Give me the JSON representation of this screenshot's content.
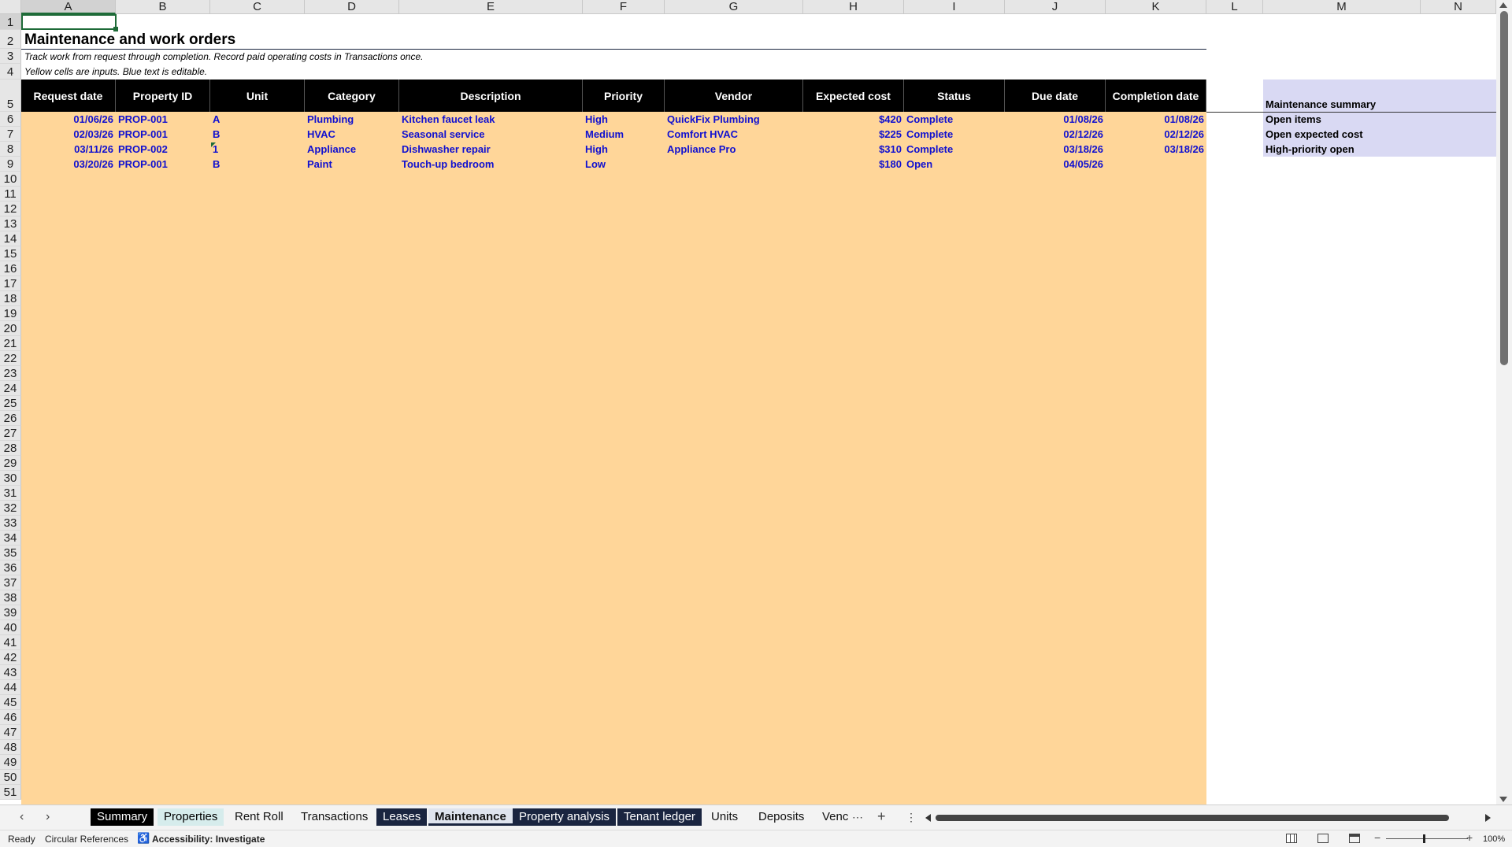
{
  "columns": [
    "A",
    "B",
    "C",
    "D",
    "E",
    "F",
    "G",
    "H",
    "I",
    "J",
    "K",
    "L",
    "M",
    "N"
  ],
  "rows_visible": [
    "1",
    "2",
    "3",
    "4",
    "5",
    "6",
    "7",
    "8",
    "9",
    "10",
    "11",
    "12",
    "13",
    "14",
    "15",
    "16",
    "17",
    "18",
    "19",
    "20",
    "21",
    "22",
    "23",
    "24",
    "25",
    "26",
    "27",
    "28",
    "29",
    "30",
    "31",
    "32",
    "33",
    "34",
    "35",
    "36",
    "37",
    "38",
    "39",
    "40",
    "41",
    "42",
    "43",
    "44",
    "45",
    "46",
    "47",
    "48",
    "49",
    "50",
    "51"
  ],
  "sheet": {
    "title": "Maintenance and work orders",
    "note1": "Track work from request through completion. Record paid operating costs in Transactions once.",
    "note2": "Yellow cells are inputs. Blue text is editable."
  },
  "table": {
    "headers": [
      "Request date",
      "Property ID",
      "Unit",
      "Category",
      "Description",
      "Priority",
      "Vendor",
      "Expected cost",
      "Status",
      "Due date",
      "Completion date"
    ],
    "rows": [
      [
        "01/06/26",
        "PROP-001",
        "A",
        "Plumbing",
        "Kitchen faucet leak",
        "High",
        "QuickFix Plumbing",
        "$420",
        "Complete",
        "01/08/26",
        "01/08/26"
      ],
      [
        "02/03/26",
        "PROP-001",
        "B",
        "HVAC",
        "Seasonal service",
        "Medium",
        "Comfort HVAC",
        "$225",
        "Complete",
        "02/12/26",
        "02/12/26"
      ],
      [
        "03/11/26",
        "PROP-002",
        "1",
        "Appliance",
        "Dishwasher repair",
        "High",
        "Appliance Pro",
        "$310",
        "Complete",
        "03/18/26",
        "03/18/26"
      ],
      [
        "03/20/26",
        "PROP-001",
        "B",
        "Paint",
        "Touch-up bedroom",
        "Low",
        "",
        "$180",
        "Open",
        "04/05/26",
        ""
      ]
    ]
  },
  "summary": {
    "title": "Maintenance summary",
    "items": [
      "Open items",
      "Open expected cost",
      "High-priority open"
    ]
  },
  "tabs": [
    {
      "label": "Summary",
      "style": "black"
    },
    {
      "label": "Properties",
      "style": "teal"
    },
    {
      "label": "Rent Roll",
      "style": "plain"
    },
    {
      "label": "Transactions",
      "style": "plain"
    },
    {
      "label": "Leases",
      "style": "navy"
    },
    {
      "label": "Maintenance",
      "style": "active"
    },
    {
      "label": "Property analysis",
      "style": "navy"
    },
    {
      "label": "Tenant ledger",
      "style": "navy"
    },
    {
      "label": "Units",
      "style": "plain"
    },
    {
      "label": "Deposits",
      "style": "plain"
    },
    {
      "label": "Venc",
      "style": "plain"
    }
  ],
  "status_bar": {
    "ready": "Ready",
    "circular": "Circular References",
    "accessibility": "Accessibility: Investigate",
    "zoom": "100%"
  },
  "colors": {
    "input_fill": "#ffd699",
    "header_fill": "#000000",
    "summary_fill": "#d9d9f3",
    "editable_text": "#1010d0"
  }
}
